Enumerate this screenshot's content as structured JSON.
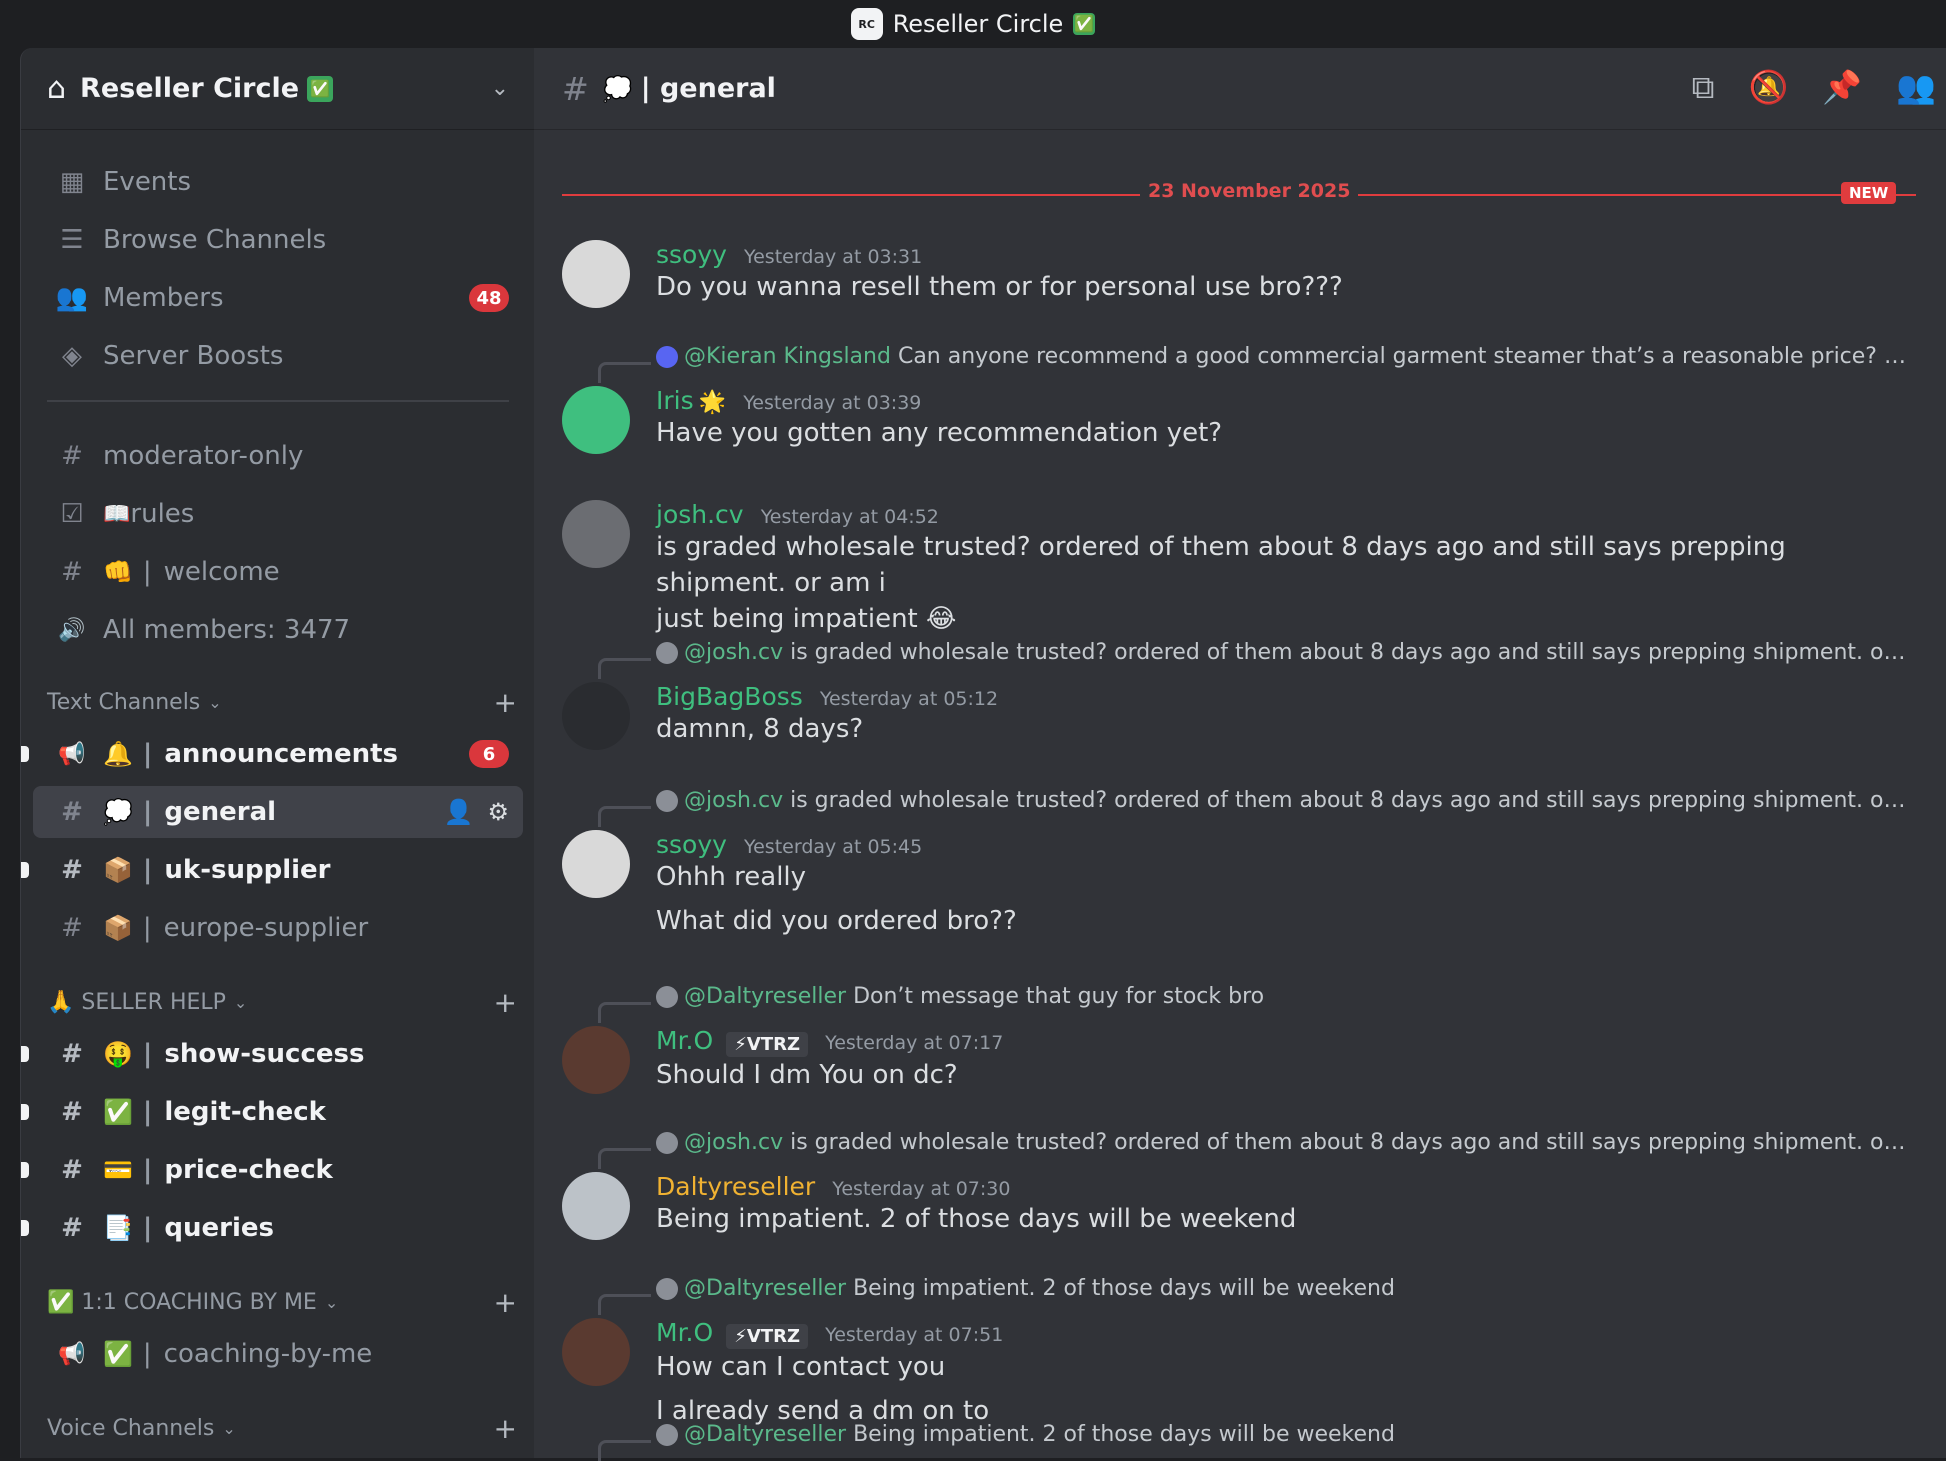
{
  "window": {
    "title": "Reseller Circle",
    "title_check": "✅",
    "logo_text": "RESELLER CIRCLE"
  },
  "sidebar": {
    "server_name": "Reseller Circle",
    "server_check": "✅",
    "chevron": "⌄",
    "nav": [
      {
        "label": "Events",
        "icon": "calendar-icon",
        "glyph": "▦"
      },
      {
        "label": "Browse Channels",
        "icon": "browse-channels-icon",
        "glyph": "☰"
      },
      {
        "label": "Members",
        "icon": "members-icon",
        "glyph": "👥",
        "badge": "48"
      },
      {
        "label": "Server Boosts",
        "icon": "boost-icon",
        "glyph": "◈"
      }
    ],
    "channels_top": [
      {
        "label": "moderator-only",
        "glyph": "#",
        "emoji": "",
        "sep": ""
      },
      {
        "label": "rules",
        "glyph": "☑",
        "emoji": "📖",
        "sep": ""
      },
      {
        "label": "welcome",
        "glyph": "#",
        "emoji": "👊",
        "sep": "|"
      },
      {
        "label": "All members: 3477",
        "glyph": "🔊",
        "emoji": "",
        "sep": ""
      }
    ],
    "categories": [
      {
        "label": "Text Channels",
        "plus": "+"
      },
      {
        "label": "🙏 SELLER HELP",
        "plus": "+"
      },
      {
        "label": "✅ 1:1 COACHING BY ME",
        "plus": "+"
      },
      {
        "label": "Voice Channels",
        "plus": "+"
      }
    ],
    "text_channels": [
      {
        "label": "announcements",
        "glyph": "📢",
        "emoji": "🔔",
        "sep": "|",
        "badge": "6"
      },
      {
        "label": "general",
        "glyph": "#",
        "emoji": "💭",
        "sep": "|"
      },
      {
        "label": "uk-supplier",
        "glyph": "#",
        "emoji": "📦",
        "sep": "|"
      },
      {
        "label": "europe-supplier",
        "glyph": "#",
        "emoji": "📦",
        "sep": "|"
      }
    ],
    "seller_channels": [
      {
        "label": "show-success",
        "glyph": "#",
        "emoji": "🤑",
        "sep": "|"
      },
      {
        "label": "legit-check",
        "glyph": "#",
        "emoji": "✅",
        "sep": "|"
      },
      {
        "label": "price-check",
        "glyph": "#",
        "emoji": "💳",
        "sep": "|"
      },
      {
        "label": "queries",
        "glyph": "#",
        "emoji": "📑",
        "sep": "|"
      }
    ],
    "coaching_channels": [
      {
        "label": "coaching-by-me",
        "glyph": "📢",
        "emoji": "✅",
        "sep": "|"
      }
    ]
  },
  "channel": {
    "hash": "#",
    "emoji": "💭",
    "name": "| general"
  },
  "date_divider": {
    "label": "23 November 2025",
    "new": "NEW"
  },
  "messages": [
    {
      "author": "ssoyy",
      "ts": "Yesterday at 03:31",
      "lines": [
        "Do you wanna resell them or for personal use bro???"
      ]
    },
    {
      "reply_mention": "@Kieran Kingsland",
      "reply_text": "Can anyone recommend a good commercial garment steamer that’s a reasonable price? Not loo...",
      "author": "Iris",
      "author_badge": "🌟",
      "ts": "Yesterday at 03:39",
      "lines": [
        "Have you gotten any recommendation yet?"
      ]
    },
    {
      "author": "josh.cv",
      "ts": "Yesterday at 04:52",
      "lines": [
        "is graded wholesale trusted? ordered of them about 8 days ago and still says prepping shipment. or am i",
        "just being impatient 😂"
      ]
    },
    {
      "reply_mention": "@josh.cv",
      "reply_text": "is graded wholesale trusted? ordered of them about 8 days ago and still says prepping shipment. or am i ju...",
      "author": "BigBagBoss",
      "ts": "Yesterday at 05:12",
      "lines": [
        "damnn, 8 days?"
      ]
    },
    {
      "reply_mention": "@josh.cv",
      "reply_text": "is graded wholesale trusted? ordered of them about 8 days ago and still says prepping shipment. or am i ju...",
      "author": "ssoyy",
      "ts": "Yesterday at 05:45",
      "lines": [
        "Ohhh really",
        "What did you ordered bro??"
      ]
    },
    {
      "reply_mention": "@Daltyreseller",
      "reply_text": "Don’t message that guy for stock bro",
      "author": "Mr.O",
      "tag": "⚡VTRZ",
      "ts": "Yesterday at 07:17",
      "lines": [
        "Should I dm You on dc?"
      ]
    },
    {
      "reply_mention": "@josh.cv",
      "reply_text": "is graded wholesale trusted? ordered of them about 8 days ago and still says prepping shipment. or am i ju...",
      "author": "Daltyreseller",
      "ts": "Yesterday at 07:30",
      "lines": [
        "Being impatient. 2 of those days will be weekend"
      ]
    },
    {
      "reply_mention": "@Daltyreseller",
      "reply_text": "Being impatient. 2 of those days will be weekend",
      "author": "Mr.O",
      "tag": "⚡VTRZ",
      "ts": "Yesterday at 07:51",
      "lines": [
        "How can I contact you",
        "I already send a dm on to"
      ]
    },
    {
      "reply_mention": "@Daltyreseller",
      "reply_text": "Being impatient. 2 of those days will be weekend"
    }
  ]
}
